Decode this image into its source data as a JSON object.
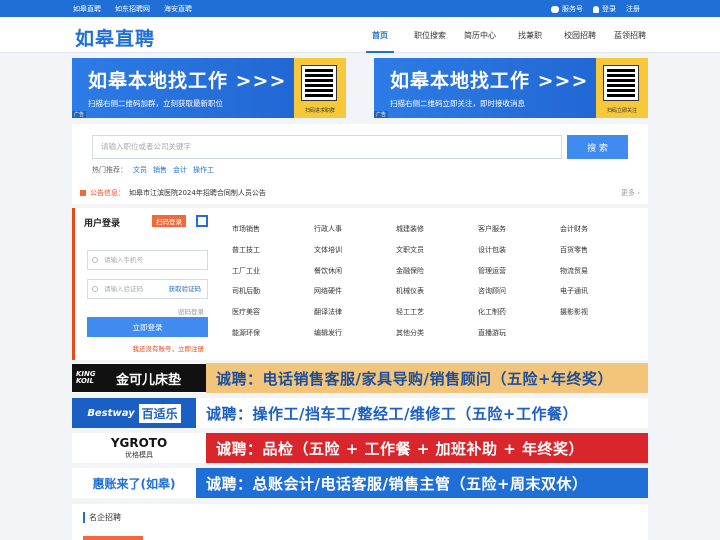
{
  "topbar": {
    "links": [
      "如皋直聘",
      "如东招聘网",
      "海安直聘"
    ],
    "service": "服务号",
    "login": "登录",
    "register": "注册"
  },
  "header": {
    "logo": "如皋直聘",
    "nav": [
      "首页",
      "职位搜索",
      "简历中心",
      "找兼职",
      "校园招聘",
      "蓝领招聘"
    ],
    "active_nav": "首页"
  },
  "ads": [
    {
      "title": "如皋本地找工作 >>>",
      "subtitle": "扫描右侧二维码加群，立刻获取最新职位",
      "qr_caption": "扫码进求职群",
      "tag": "广告"
    },
    {
      "title": "如皋本地找工作 >>>",
      "subtitle": "扫描右侧二维码立即关注，即时接收消息",
      "qr_caption": "扫码立即关注",
      "tag": "广告"
    }
  ],
  "search": {
    "placeholder": "请输入职位或者公司关键字",
    "button": "搜 索",
    "hot_label": "热门推荐：",
    "hot_items": [
      "文员",
      "销售",
      "会计",
      "操作工"
    ]
  },
  "notice": {
    "label": "公告信息：",
    "text": "如皋市江滨医院2024年招聘合同制人员公告",
    "more": "更多 ›"
  },
  "login": {
    "title": "用户登录",
    "scan_label": "扫码登录",
    "phone_placeholder": "请输入手机号",
    "code_placeholder": "请输入验证码",
    "get_code": "获取验证码",
    "password_login": "密码登录",
    "login_button": "立即登录",
    "register_prompt": "我还没有账号，立即注册"
  },
  "categories": [
    "市场销售",
    "行政人事",
    "城建装修",
    "客户服务",
    "会计财务",
    "普工技工",
    "文体培训",
    "文职文员",
    "设计包装",
    "百货零售",
    "工厂工业",
    "餐饮休闲",
    "金融保险",
    "管理运营",
    "物流贸易",
    "司机后勤",
    "网络硬件",
    "机械仪表",
    "咨询顾问",
    "电子通讯",
    "医疗美容",
    "翻译法律",
    "轻工工艺",
    "化工制药",
    "摄影影视",
    "能源环保",
    "编辑发行",
    "其他分类",
    "直播游玩"
  ],
  "banners": [
    {
      "logo_line1": "KING KOIL",
      "logo_line2": "金可儿床垫",
      "text": "诚聘：电话销售客服/家具导购/销售顾问（五险+年终奖）",
      "bg": "#f3c57a",
      "text_color": "#1d4e9b",
      "logo_bg": "#ffffff"
    },
    {
      "logo_line1": "Bestway",
      "logo_line2": "百适乐",
      "text": "诚聘：操作工/挡车工/整经工/维修工（五险+工作餐）",
      "bg": "#1f6fd6",
      "text_color": "#ffffff",
      "logo_bg": "#ffffff",
      "tag": "广告"
    },
    {
      "logo_line1": "YGROTO",
      "logo_line2": "优格模具",
      "text": "诚聘：品检（五险 + 工作餐 + 加班补助 + 年终奖）",
      "bg": "#d9262c",
      "text_color": "#ffffff",
      "logo_bg": "#ffffff"
    },
    {
      "logo_line1": "惠账来了(如皋)",
      "logo_line2": "",
      "text": "诚聘：总账会计/电话客服/销售主管（五险+周末双休）",
      "bg": "#1f6fd6",
      "text_color": "#ffffff",
      "logo_bg": "#ffffff"
    }
  ],
  "famous": {
    "title": "名企招聘"
  }
}
